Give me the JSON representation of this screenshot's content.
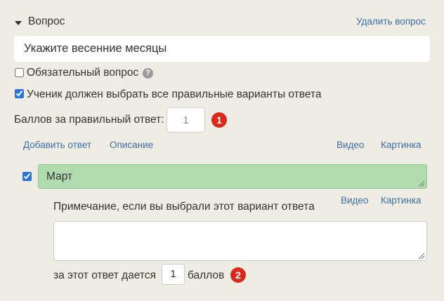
{
  "question": {
    "section_title": "Вопрос",
    "delete_label": "Удалить вопрос",
    "text": "Укажите весенние месяцы",
    "required_label": "Обязательный вопрос",
    "required_checked": false,
    "help_glyph": "?",
    "select_all_label": "Ученик должен выбрать все правильные варианты ответа",
    "select_all_checked": true,
    "points_label": "Баллов за правильный ответ:",
    "points_value": "1",
    "badge_1": "1"
  },
  "toolbar": {
    "add_answer": "Добавить ответ",
    "description": "Описание",
    "video": "Видео",
    "picture": "Картинка"
  },
  "answer": {
    "checked": true,
    "text": "Март",
    "note_label": "Примечание, если вы выбрали этот вариант ответа",
    "video": "Видео",
    "picture": "Картинка",
    "note_value": "",
    "points_prefix": "за этот ответ дается",
    "points_value": "1",
    "points_suffix": "баллов",
    "badge_2": "2"
  },
  "colors": {
    "background": "#efece3",
    "link": "#3a6fa8",
    "correct_answer_fill": "#b0dcb0",
    "badge": "#d9281c"
  }
}
